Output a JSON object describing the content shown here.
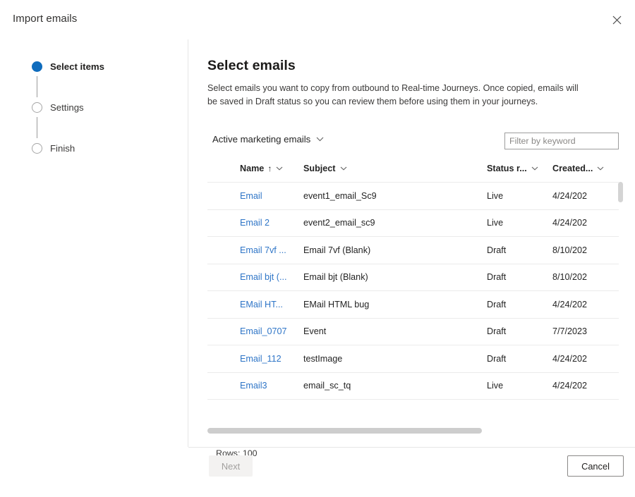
{
  "dialog": {
    "title": "Import emails",
    "close_icon": "close-icon"
  },
  "stepper": {
    "steps": [
      {
        "label": "Select items",
        "state": "active"
      },
      {
        "label": "Settings",
        "state": "inactive"
      },
      {
        "label": "Finish",
        "state": "inactive"
      }
    ]
  },
  "pane": {
    "title": "Select emails",
    "description": "Select emails you want to copy from outbound to Real-time Journeys. Once copied, emails will be saved in Draft status so you can review them before using them in your journeys."
  },
  "toolbar": {
    "view_selector_label": "Active marketing emails",
    "view_selector_icon": "chevron-down-icon",
    "filter_placeholder": "Filter by keyword",
    "filter_value": ""
  },
  "grid": {
    "columns": [
      {
        "key": "check",
        "label": "",
        "sort": "",
        "chevron": ""
      },
      {
        "key": "name",
        "label": "Name",
        "sort": "↑",
        "chevron": "chevron-down-icon"
      },
      {
        "key": "subject",
        "label": "Subject",
        "sort": "",
        "chevron": "chevron-down-icon"
      },
      {
        "key": "status",
        "label": "Status r...",
        "sort": "",
        "chevron": "chevron-down-icon"
      },
      {
        "key": "created",
        "label": "Created...",
        "sort": "",
        "chevron": "chevron-down-icon"
      }
    ],
    "rows": [
      {
        "name": "Email",
        "subject": "event1_email_Sc9",
        "status": "Live",
        "created": "4/24/202"
      },
      {
        "name": "Email 2",
        "subject": "event2_email_sc9",
        "status": "Live",
        "created": "4/24/202"
      },
      {
        "name": "Email 7vf ...",
        "subject": "Email 7vf (Blank)",
        "status": "Draft",
        "created": "8/10/202"
      },
      {
        "name": "Email bjt (...",
        "subject": "Email bjt (Blank)",
        "status": "Draft",
        "created": "8/10/202"
      },
      {
        "name": "EMail HT...",
        "subject": "EMail HTML bug",
        "status": "Draft",
        "created": "4/24/202"
      },
      {
        "name": "Email_0707",
        "subject": "Event",
        "status": "Draft",
        "created": "7/7/2023"
      },
      {
        "name": "Email_112",
        "subject": "testImage",
        "status": "Draft",
        "created": "4/24/202"
      },
      {
        "name": "Email3",
        "subject": "email_sc_tq",
        "status": "Live",
        "created": "4/24/202"
      }
    ],
    "rows_count_label": "Rows: 100"
  },
  "footer": {
    "next_label": "Next",
    "cancel_label": "Cancel"
  },
  "colors": {
    "accent": "#0f6cbd",
    "link": "#2e75c7",
    "divider": "#e6e6e6",
    "row_divider": "#ebebeb",
    "scrollbar": "#cdcdcd"
  }
}
